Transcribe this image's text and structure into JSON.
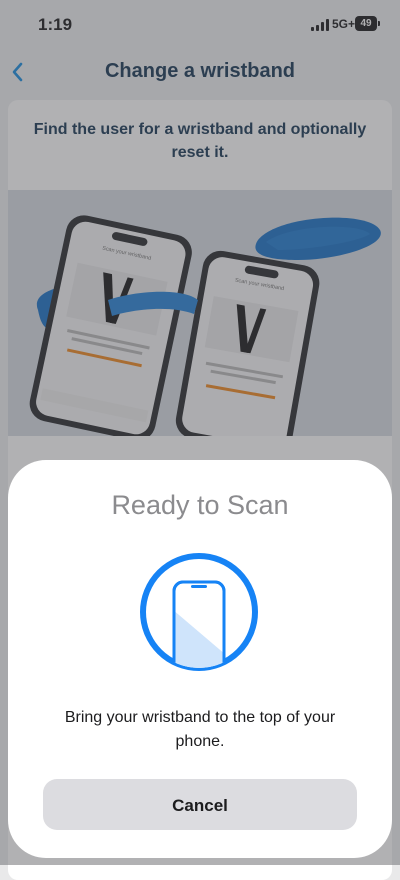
{
  "status_bar": {
    "time": "1:19",
    "network": "5G+",
    "battery": "49"
  },
  "nav": {
    "title": "Change a wristband",
    "back_icon": "chevron-left-icon"
  },
  "card": {
    "header": "Find the user for a wristband and optionally reset it.",
    "illustration": "phones-with-wristband-image",
    "phone_left_screen_heading": "Scan your wristband",
    "phone_right_screen_heading": "Scan your wristband"
  },
  "scan_sheet": {
    "title": "Ready to Scan",
    "icon": "phone-scan-icon",
    "message": "Bring your wristband to the top of your phone.",
    "cancel_label": "Cancel"
  },
  "colors": {
    "nav_title": "#1a3a56",
    "back_icon": "#1a8ee0",
    "scan_ring": "#1683f5",
    "wristband": "#1d74c8",
    "accent_orange": "#f08a24"
  }
}
